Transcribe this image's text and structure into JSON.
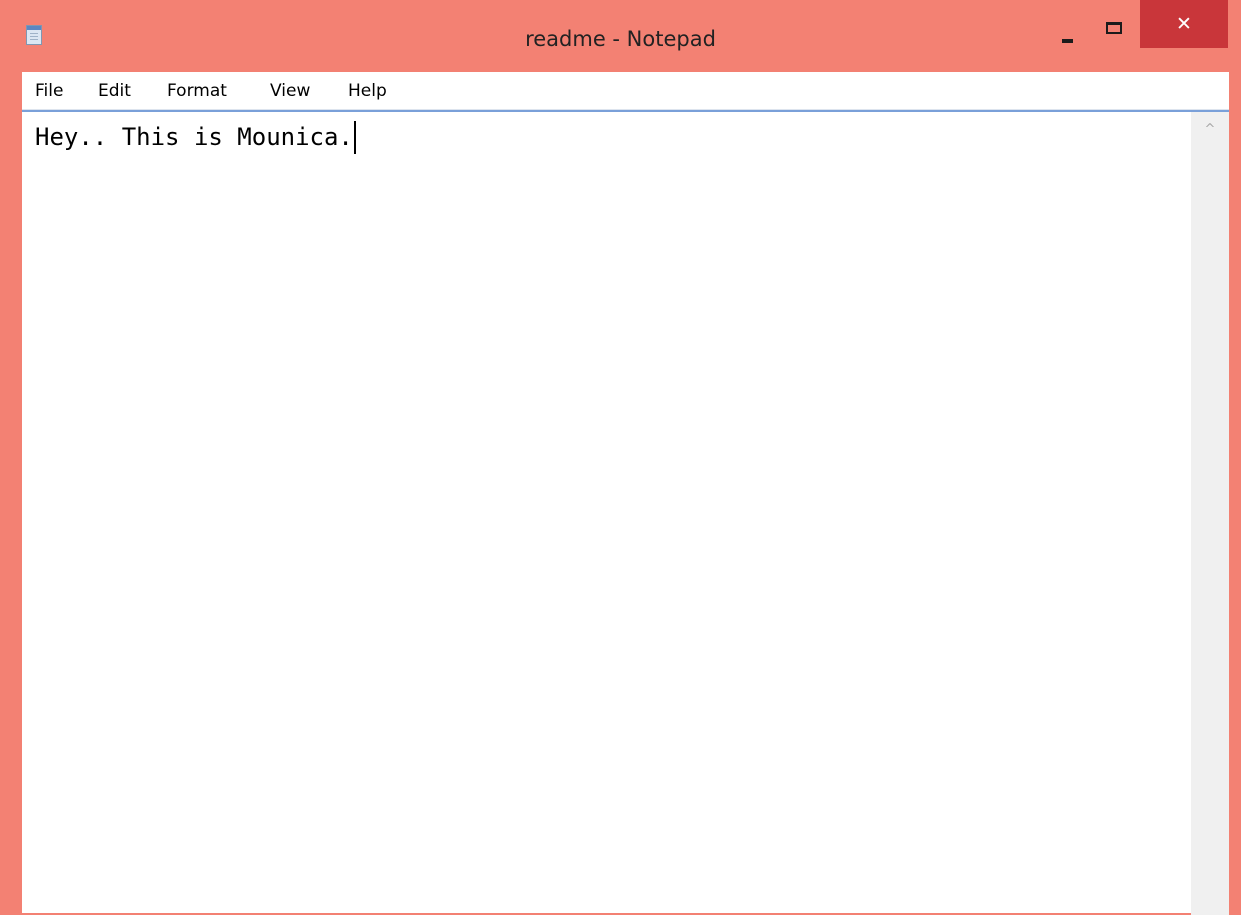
{
  "window": {
    "title": "readme - Notepad",
    "icon": "notepad-icon",
    "controls": {
      "minimize_icon": "minimize-icon",
      "maximize_icon": "maximize-icon",
      "close_icon": "close-icon",
      "close_glyph": "✕"
    },
    "colors": {
      "frame": "#f38173",
      "close_button": "#c9363a",
      "editor_background": "#ffffff",
      "editor_border": "#7aa0d9"
    }
  },
  "menu": {
    "items": [
      {
        "label": "File"
      },
      {
        "label": "Edit"
      },
      {
        "label": "Format"
      },
      {
        "label": "View"
      },
      {
        "label": "Help"
      }
    ]
  },
  "editor": {
    "content": "Hey.. This is Mounica."
  },
  "scrollbar": {
    "up_glyph": "^",
    "up_icon": "chevron-up-icon"
  }
}
